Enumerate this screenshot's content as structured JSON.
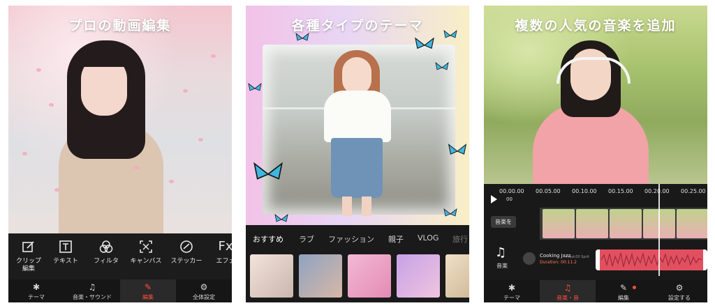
{
  "panels": {
    "editing": {
      "title": "プロの動画編集",
      "tools": [
        {
          "icon": "edit-clip-icon",
          "label": "クリップ\n編集"
        },
        {
          "icon": "text-icon",
          "label": "テキスト"
        },
        {
          "icon": "filter-icon",
          "label": "フィルタ"
        },
        {
          "icon": "canvas-icon",
          "label": "キャンバス"
        },
        {
          "icon": "sticker-icon",
          "label": "ステッカー"
        },
        {
          "icon": "effects-icon",
          "label": "エフェ"
        }
      ],
      "nav": [
        {
          "icon": "theme-icon",
          "label": "テーマ"
        },
        {
          "icon": "music-sound-icon",
          "label": "音楽・サウンド"
        },
        {
          "icon": "edit-icon",
          "label": "編集"
        },
        {
          "icon": "settings-icon",
          "label": "全体設定"
        }
      ]
    },
    "themes": {
      "title": "各種タイプのテーマ",
      "tabs": [
        "おすすめ",
        "ラブ",
        "ファッション",
        "親子",
        "VLOG",
        "旅行"
      ]
    },
    "music": {
      "title": "複数の人気の音楽を追加",
      "timecodes": [
        "00.00.00",
        "00.05.00",
        "00.10.00",
        "00.15.00",
        "00.20.00",
        "00.25.00"
      ],
      "current_time": "00",
      "add_music_button": "音楽を",
      "music_tool_label": "音楽",
      "track": {
        "title": "Cooking Jazz",
        "duration": "Duration: 00:11.2",
        "author": "Fresh30 Sprit"
      },
      "nav": [
        {
          "icon": "theme-icon",
          "label": "テーマ"
        },
        {
          "icon": "music-sound-icon",
          "label": "音楽・音"
        },
        {
          "icon": "edit-icon",
          "label": "編集"
        },
        {
          "icon": "settings-icon",
          "label": "設定する"
        }
      ]
    }
  },
  "colors": {
    "accent": "#ff4f3d",
    "toolbar": "#1c1c1c",
    "waveform": "#e25060"
  }
}
